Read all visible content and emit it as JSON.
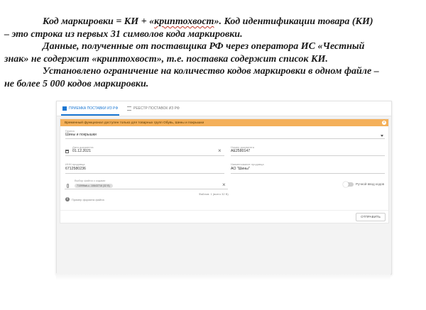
{
  "document": {
    "line1": "Код маркировки = КИ +  «",
    "line1_underlined": "криптохвост",
    "line1_rest": "». Код идентификации товара (КИ)",
    "line2": "– это строка из первых 31 символов кода маркировки.",
    "line3": "Данные, полученные от поставщика РФ через оператора ИС «Честный",
    "line4": "знак» не содержит «криптохвост», т.е. поставка содержит список КИ.",
    "line5": "Установлено ограничение на количество кодов маркировки в одном файле –",
    "line6": "не более  5 000 кодов маркировки."
  },
  "app": {
    "tabs": [
      {
        "label": "ПРИЕМКА ПОСТАВКИ ИЗ РФ",
        "icon": "document-icon",
        "active": true
      },
      {
        "label": "РЕЕСТР ПОСТАВОК ИЗ РФ",
        "icon": "list-icon",
        "active": false
      }
    ],
    "accent": "#1976d2",
    "banner": {
      "text": "Временный функционал доступен только для товарных групп Обувь, Шины и покрышки",
      "color": "#f4b05a"
    },
    "group": {
      "label": "Группа",
      "value": "Шины и покрышки"
    },
    "doc_date": {
      "label": "Дата документа",
      "value": "01.12.2021"
    },
    "doc_number": {
      "label": "Номер документа",
      "value": "АЕ2580147"
    },
    "inn": {
      "label": "ИНН продавца",
      "value": "6712580236"
    },
    "seller_name": {
      "label": "Наименование продавца",
      "value": "АО \"Шины\""
    },
    "file": {
      "label": "Выбор файла с кодами",
      "chip": "71099fab-c..10643716 (32 B)",
      "count": "Файлов: 1 (всего 32 B)"
    },
    "manual_toggle": {
      "label": "Ручной ввод кодов",
      "on": false
    },
    "format_hint": "Пример формата файла",
    "send_button": "ОТПРАВИТЬ"
  }
}
